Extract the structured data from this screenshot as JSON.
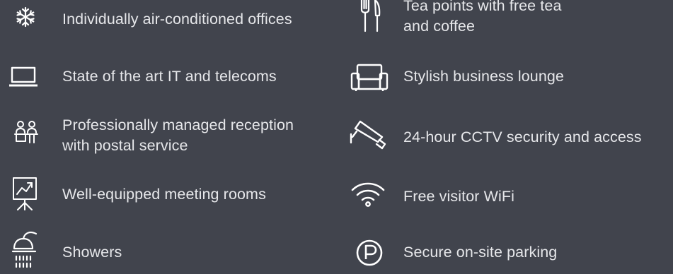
{
  "colors": {
    "background": "#41444d",
    "text": "#e6e7ea",
    "icon": "#ffffff"
  },
  "amenities": {
    "left": [
      {
        "icon": "snowflake-icon",
        "lines": [
          "Individually air-conditioned offices"
        ]
      },
      {
        "icon": "laptop-icon",
        "lines": [
          "State of the art IT and telecoms"
        ]
      },
      {
        "icon": "reception-icon",
        "lines": [
          "Professionally managed reception",
          "with postal service"
        ]
      },
      {
        "icon": "presentation-board-icon",
        "lines": [
          "Well-equipped meeting rooms"
        ]
      },
      {
        "icon": "shower-icon",
        "lines": [
          "Showers"
        ]
      }
    ],
    "right": [
      {
        "icon": "cutlery-icon",
        "lines": [
          "Tea points with free tea",
          "and coffee"
        ]
      },
      {
        "icon": "sofa-icon",
        "lines": [
          "Stylish business lounge"
        ]
      },
      {
        "icon": "cctv-camera-icon",
        "lines": [
          "24-hour CCTV security and access"
        ]
      },
      {
        "icon": "wifi-icon",
        "lines": [
          "Free visitor WiFi"
        ]
      },
      {
        "icon": "parking-icon",
        "lines": [
          "Secure on-site parking"
        ]
      }
    ]
  }
}
